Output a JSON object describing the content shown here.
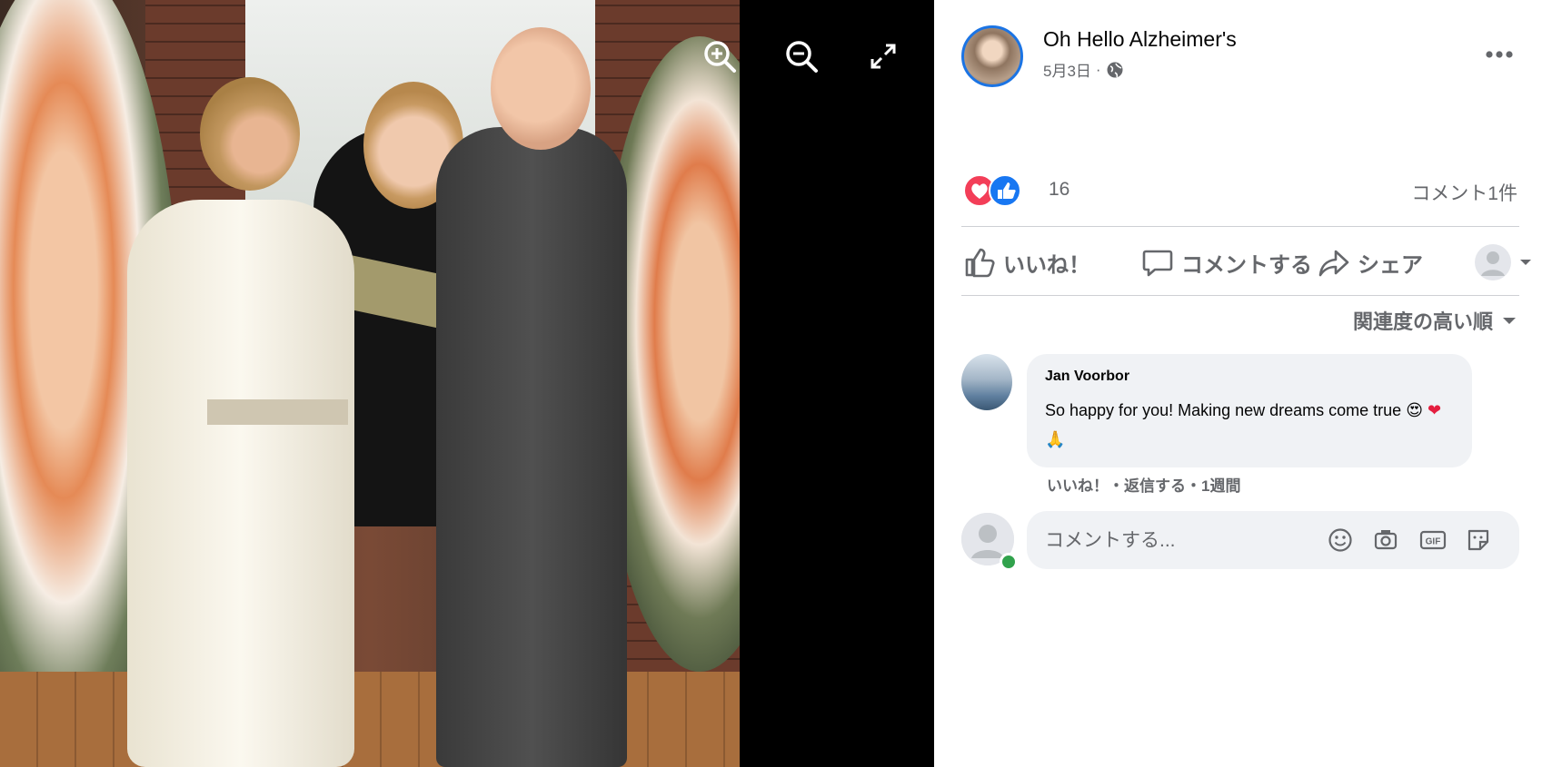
{
  "viewer": {
    "icons": {
      "zoom_in": "zoom-in-icon",
      "zoom_out": "zoom-out-icon",
      "fullscreen": "fullscreen-icon"
    }
  },
  "post": {
    "page_name": "Oh Hello Alzheimer's",
    "date": "5月3日",
    "separator": "·",
    "privacy_icon": "globe-icon",
    "reaction_count": "16",
    "comment_count": "コメント1件",
    "reaction_types": [
      "love",
      "like"
    ]
  },
  "actions": {
    "like": "いいね！",
    "comment": "コメントする",
    "share": "シェア"
  },
  "sort": {
    "label": "関連度の高い順"
  },
  "comment": {
    "author": "Jan Voorbor",
    "text": "So happy for you! Making new dreams come true",
    "emojis": [
      "😍",
      "❤",
      "🙏"
    ],
    "actions": "いいね！・返信する・1週間"
  },
  "composer": {
    "placeholder": "コメントする..."
  },
  "colors": {
    "accent": "#1b74e4",
    "secondary_text": "#65676b",
    "bubble": "#f0f2f5",
    "online": "#31a24c",
    "love": "#f33e58",
    "like": "#1877f2"
  }
}
